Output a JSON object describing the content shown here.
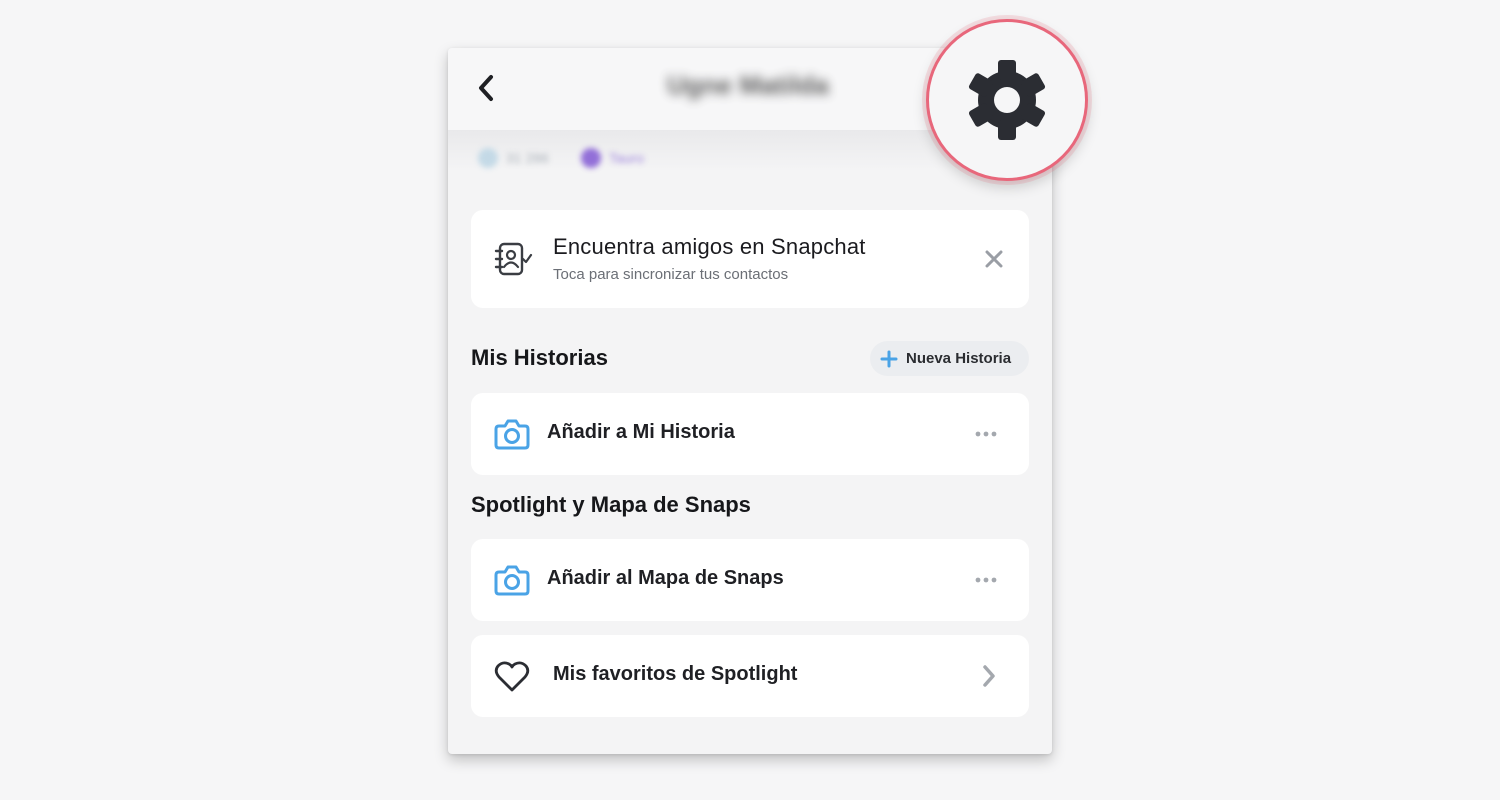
{
  "header": {
    "profile_name": "Ugne Matilda",
    "back_icon": "chevron-left-icon",
    "settings_icon": "gear-icon"
  },
  "badges": {
    "score": "31 286",
    "zodiac": "Tauro"
  },
  "find_friends": {
    "title": "Encuentra amigos en Snapchat",
    "subtitle": "Toca para sincronizar tus contactos",
    "icon": "contacts-book-icon",
    "close_icon": "close-icon"
  },
  "my_stories": {
    "title": "Mis Historias",
    "new_story_label": "Nueva Historia",
    "add_story_label": "Añadir a Mi Historia"
  },
  "spotlight": {
    "title": "Spotlight y Mapa de Snaps",
    "add_map_label": "Añadir al Mapa de Snaps",
    "favorites_label": "Mis favoritos de Spotlight"
  },
  "colors": {
    "accent_blue": "#4aa3e6",
    "highlight_ring": "#e8677b",
    "icon_dark": "#2b2d33"
  }
}
